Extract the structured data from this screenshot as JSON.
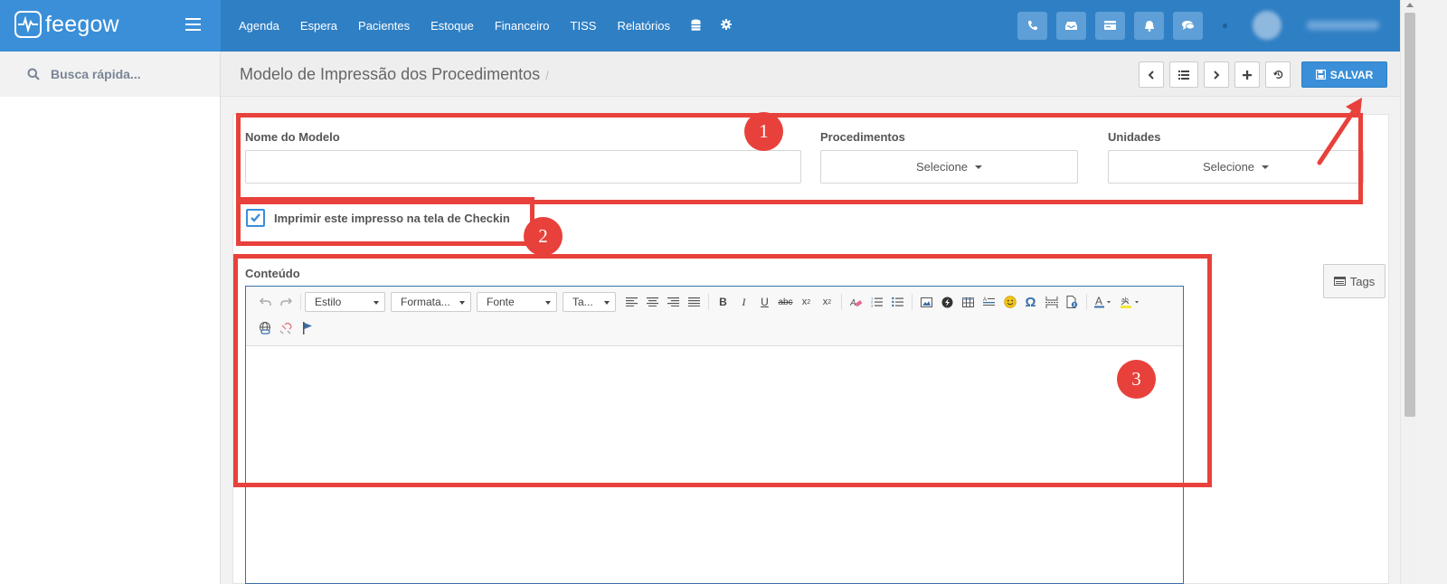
{
  "brand": {
    "name": "feegow"
  },
  "nav": {
    "items": [
      "Agenda",
      "Espera",
      "Pacientes",
      "Estoque",
      "Financeiro",
      "TISS",
      "Relatórios"
    ],
    "icons": [
      "database-icon",
      "gear-icon"
    ]
  },
  "top_actions": [
    "phone-icon",
    "inbox-icon",
    "card-icon",
    "bell-icon",
    "chat-icon"
  ],
  "sidebar": {
    "search_placeholder": "Busca rápida..."
  },
  "page": {
    "title": "Modelo de Impressão dos Procedimentos",
    "separator": "/",
    "save_label": "SALVAR"
  },
  "form": {
    "nome_label": "Nome do Modelo",
    "nome_value": "",
    "procedimentos_label": "Procedimentos",
    "procedimentos_value": "Selecione",
    "unidades_label": "Unidades",
    "unidades_value": "Selecione",
    "checkin_label": "Imprimir este impresso na tela de Checkin",
    "checkin_checked": true,
    "conteudo_label": "Conteúdo"
  },
  "editor": {
    "combos": [
      "Estilo",
      "Formata...",
      "Fonte",
      "Ta..."
    ]
  },
  "tags_label": "Tags",
  "annotations": [
    "1",
    "2",
    "3"
  ],
  "colors": {
    "brand_blue": "#2f7fc4",
    "accent": "#3a8fd8",
    "annotation_red": "#e8413b"
  }
}
